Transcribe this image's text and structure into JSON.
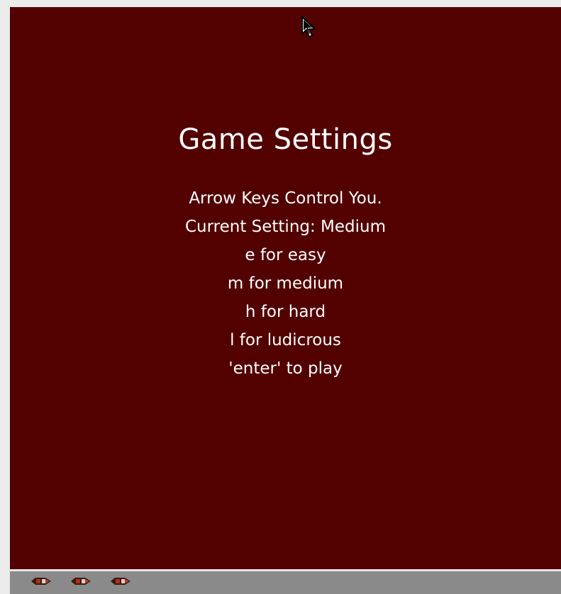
{
  "game": {
    "title": "Game Settings",
    "instructions": [
      "Arrow Keys Control You.",
      "Current Setting: Medium",
      "e for easy",
      "m for medium",
      "h for hard",
      "l for ludicrous",
      "'enter' to play"
    ],
    "background_color": "#520000",
    "text_color": "#ffffff"
  },
  "status_bar": {
    "lives_remaining": 3,
    "life_icon": "ship-icon"
  }
}
